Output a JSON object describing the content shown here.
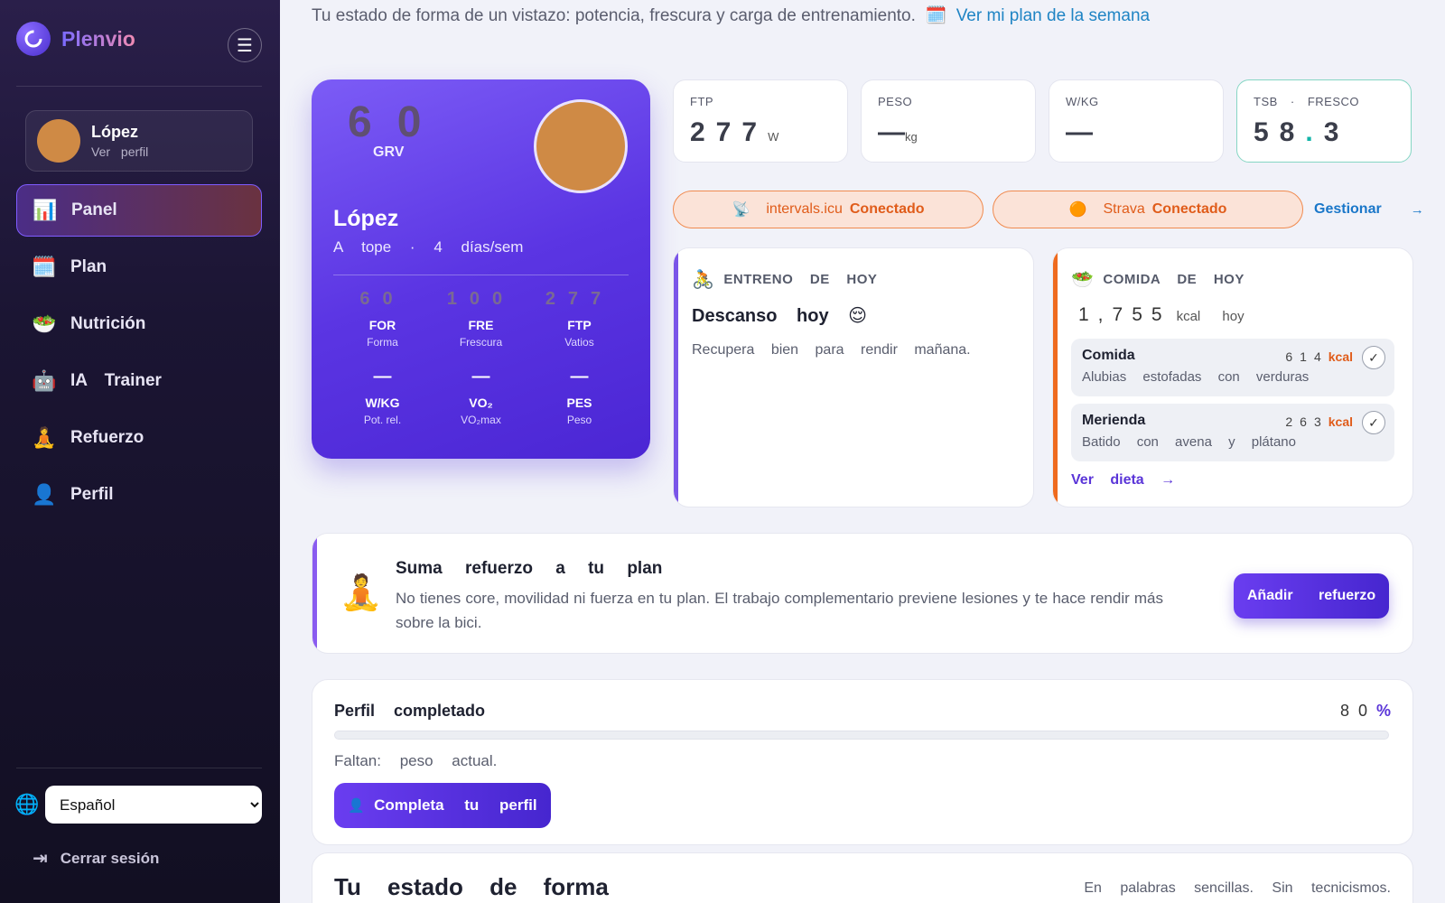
{
  "app": {
    "name": "Plenvio",
    "brand_color": "#6a3df0"
  },
  "sidebar": {
    "user": {
      "name": "López",
      "link": "Ver perfil"
    },
    "items": [
      {
        "label": "Panel",
        "icon": "chart-icon",
        "active": true
      },
      {
        "label": "Plan",
        "icon": "calendar-icon"
      },
      {
        "label": "Nutrición",
        "icon": "salad-icon"
      },
      {
        "label": "IA Trainer",
        "icon": "robot-icon"
      },
      {
        "label": "Refuerzo",
        "icon": "meditation-icon"
      },
      {
        "label": "Perfil",
        "icon": "person-icon"
      }
    ],
    "language": {
      "selected": "Español",
      "options": [
        "Español"
      ]
    },
    "logout": "Cerrar sesión"
  },
  "intro": {
    "text": "Tu estado de forma de un vistazo: potencia, frescura y carga de entrenamiento.",
    "link": "Ver mi plan de la semana"
  },
  "hero": {
    "score": "60",
    "score_label": "GRV",
    "name": "López",
    "subtitle": "A tope · 4 días/sem",
    "stats": [
      {
        "value": "60",
        "key": "FOR",
        "sub": "Forma"
      },
      {
        "value": "100",
        "key": "FRE",
        "sub": "Frescura"
      },
      {
        "value": "277",
        "key": "FTP",
        "sub": "Vatios"
      },
      {
        "value": "—",
        "key": "W/KG",
        "sub": "Pot. rel."
      },
      {
        "value": "—",
        "key": "VO₂",
        "sub": "VO₂max"
      },
      {
        "value": "—",
        "key": "PES",
        "sub": "Peso"
      }
    ]
  },
  "metrics": [
    {
      "label": "FTP",
      "value": "277",
      "unit": "W"
    },
    {
      "label": "PESO",
      "value": "—",
      "unit": "kg"
    },
    {
      "label": "W/KG",
      "value": "—",
      "unit": ""
    },
    {
      "label": "TSB · FRESCO",
      "value_int": "58",
      "value_dot": ".",
      "value_dec": "3"
    }
  ],
  "connections": [
    {
      "service": "intervals.icu",
      "status": "Conectado",
      "icon": "satellite-icon"
    },
    {
      "service": "Strava",
      "status": "Conectado",
      "icon": "orange-dot-icon"
    }
  ],
  "manage": {
    "label": "Gestionar",
    "arrow": "→"
  },
  "training": {
    "header": "ENTRENO DE HOY",
    "title": "Descanso hoy 😌",
    "text": "Recupera bien para rendir mañana."
  },
  "food": {
    "header": "COMIDA DE HOY",
    "total": "1,755",
    "total_unit": "kcal hoy",
    "meals": [
      {
        "name": "Comida",
        "kcal": "614",
        "unit": "kcal",
        "desc": "Alubias estofadas con verduras"
      },
      {
        "name": "Merienda",
        "kcal": "263",
        "unit": "kcal",
        "desc": "Batido con avena y plátano"
      }
    ],
    "link": "Ver dieta →"
  },
  "reinforcement": {
    "title": "Suma refuerzo a tu plan",
    "text": "No tienes core, movilidad ni fuerza en tu plan. El trabajo complementario previene lesiones y te hace rendir más sobre la bici.",
    "button": "Añadir refuerzo"
  },
  "profile": {
    "title": "Perfil completado",
    "percent_value": "80",
    "percent_sign": "%",
    "progress": 0.8,
    "missing": "Faltan: peso actual.",
    "button": "Completa tu perfil"
  },
  "estado": {
    "title": "Tu estado de forma",
    "subtitle": "En palabras sencillas. Sin tecnicismos."
  }
}
